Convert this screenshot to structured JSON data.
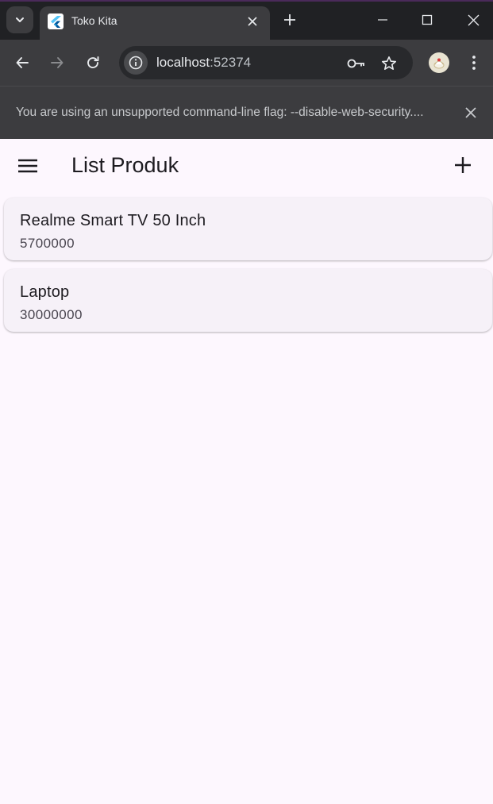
{
  "browser": {
    "tab": {
      "title": "Toko Kita"
    },
    "address_bar": {
      "host": "localhost",
      "port": ":52374"
    },
    "infobar": {
      "message": "You are using an unsupported command-line flag: --disable-web-security...."
    }
  },
  "app": {
    "title": "List Produk",
    "products": [
      {
        "name": "Realme Smart TV 50 Inch",
        "price": "5700000"
      },
      {
        "name": "Laptop",
        "price": "30000000"
      }
    ]
  },
  "colors": {
    "browser_dark": "#202124",
    "browser_toolbar": "#3c3c3f",
    "app_background": "#fdf7fe",
    "card_background": "#f6f1f8"
  },
  "icons": [
    "tab-search-icon",
    "flutter-icon",
    "close-icon",
    "plus-icon",
    "minimize-icon",
    "maximize-icon",
    "back-icon",
    "forward-icon",
    "reload-icon",
    "info-icon",
    "key-icon",
    "star-icon",
    "profile-icon",
    "more-vert-icon",
    "menu-icon"
  ]
}
